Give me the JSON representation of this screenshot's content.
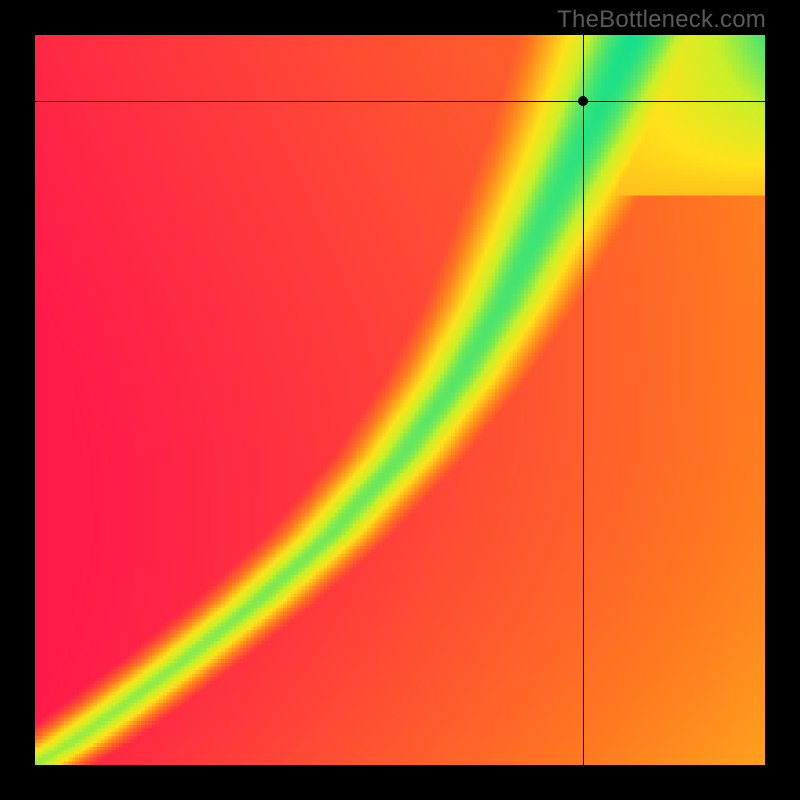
{
  "watermark": {
    "text": "TheBottleneck.com"
  },
  "chart_data": {
    "type": "heatmap",
    "title": "",
    "xlabel": "",
    "ylabel": "",
    "xlim": [
      0,
      100
    ],
    "ylim": [
      0,
      100
    ],
    "grid": false,
    "legend": false,
    "color_scale": {
      "description": "Red (worst) → Orange → Yellow → Green (optimal) ridge",
      "stops": [
        {
          "t": 0.0,
          "color": "#ff1a4a"
        },
        {
          "t": 0.35,
          "color": "#ff7a1f"
        },
        {
          "t": 0.65,
          "color": "#ffe21a"
        },
        {
          "t": 0.82,
          "color": "#c8f028"
        },
        {
          "t": 1.0,
          "color": "#16e08a"
        }
      ]
    },
    "ridge": {
      "description": "Optimal (green) path from bottom-left to top-right, curving right then up.",
      "points_xy": [
        [
          0,
          0
        ],
        [
          5,
          3
        ],
        [
          12,
          8
        ],
        [
          20,
          14
        ],
        [
          30,
          22
        ],
        [
          40,
          31
        ],
        [
          50,
          42
        ],
        [
          58,
          53
        ],
        [
          64,
          63
        ],
        [
          70,
          75
        ],
        [
          76,
          87
        ],
        [
          82,
          100
        ]
      ],
      "half_width": 5
    },
    "upper_right_broad_green": {
      "note": "Green region fans out wider near the top-right.",
      "fan_factor": 2.2
    },
    "marker": {
      "x": 75,
      "y": 91
    },
    "crosshair": {
      "x": 75,
      "y": 91
    }
  }
}
